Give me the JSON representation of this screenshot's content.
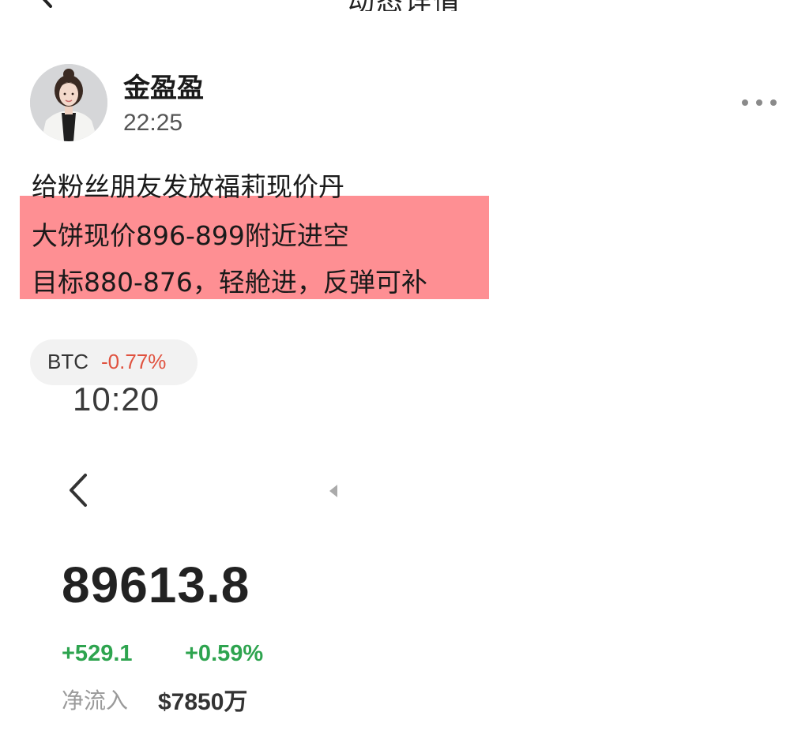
{
  "header": {
    "title": "动态详情",
    "back_icon": "chevron-left-icon"
  },
  "post": {
    "author": "金盈盈",
    "time": "22:25",
    "more_icon": "more-horizontal-icon",
    "lines": [
      "给粉丝朋友发放福莉现价丹",
      "大饼现价896-899附近进空",
      "目标880-876，轻舱进，反弹可补"
    ],
    "highlight_color": "#fe8f93"
  },
  "coin_chip": {
    "symbol": "BTC",
    "change": "-0.77%",
    "change_color": "#e0523f"
  },
  "embedded_screenshot": {
    "clock": "10:20",
    "back_icon": "chevron-left-icon",
    "price": "89613.8",
    "change_abs": "+529.1",
    "change_pct": "+0.59%",
    "positive_color": "#2ea44f",
    "net_inflow_label": "净流入",
    "net_inflow_value": "$7850万"
  }
}
